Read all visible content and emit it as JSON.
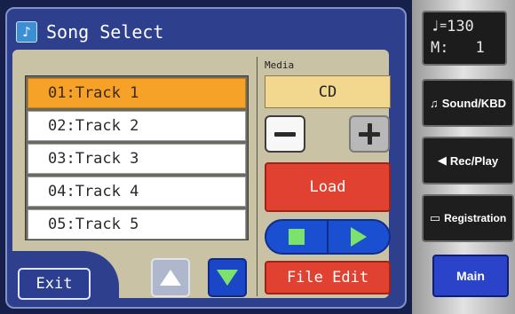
{
  "dialog": {
    "title": "Song Select",
    "title_icon": "song-note-icon"
  },
  "tracks": [
    {
      "label": "01:Track 1",
      "selected": true
    },
    {
      "label": "02:Track 2",
      "selected": false
    },
    {
      "label": "03:Track 3",
      "selected": false
    },
    {
      "label": "04:Track 4",
      "selected": false
    },
    {
      "label": "05:Track 5",
      "selected": false
    }
  ],
  "media": {
    "label": "Media",
    "value": "CD",
    "minus_icon": "minus-icon",
    "plus_icon": "plus-icon"
  },
  "buttons": {
    "load": "Load",
    "file_edit": "File Edit",
    "exit": "Exit",
    "scroll_up_icon": "up-arrow-icon",
    "scroll_down_icon": "down-arrow-icon",
    "stop_icon": "stop-icon",
    "play_icon": "play-icon"
  },
  "status": {
    "tempo_symbol": "♩",
    "tempo_eq": "=",
    "tempo": "130",
    "measure_label": "M:",
    "measure": "1"
  },
  "side_buttons": {
    "sound_kbd": "Sound/KBD",
    "rec_play": "Rec/Play",
    "registration": "Registration",
    "main": "Main"
  },
  "colors": {
    "selected_track": "#f6a127",
    "action_red": "#e04130",
    "transport_blue": "#1a4fd1",
    "transport_green": "#7be36b",
    "panel_bg": "#c9c2a4",
    "dialog_blue": "#2e3f8e"
  }
}
